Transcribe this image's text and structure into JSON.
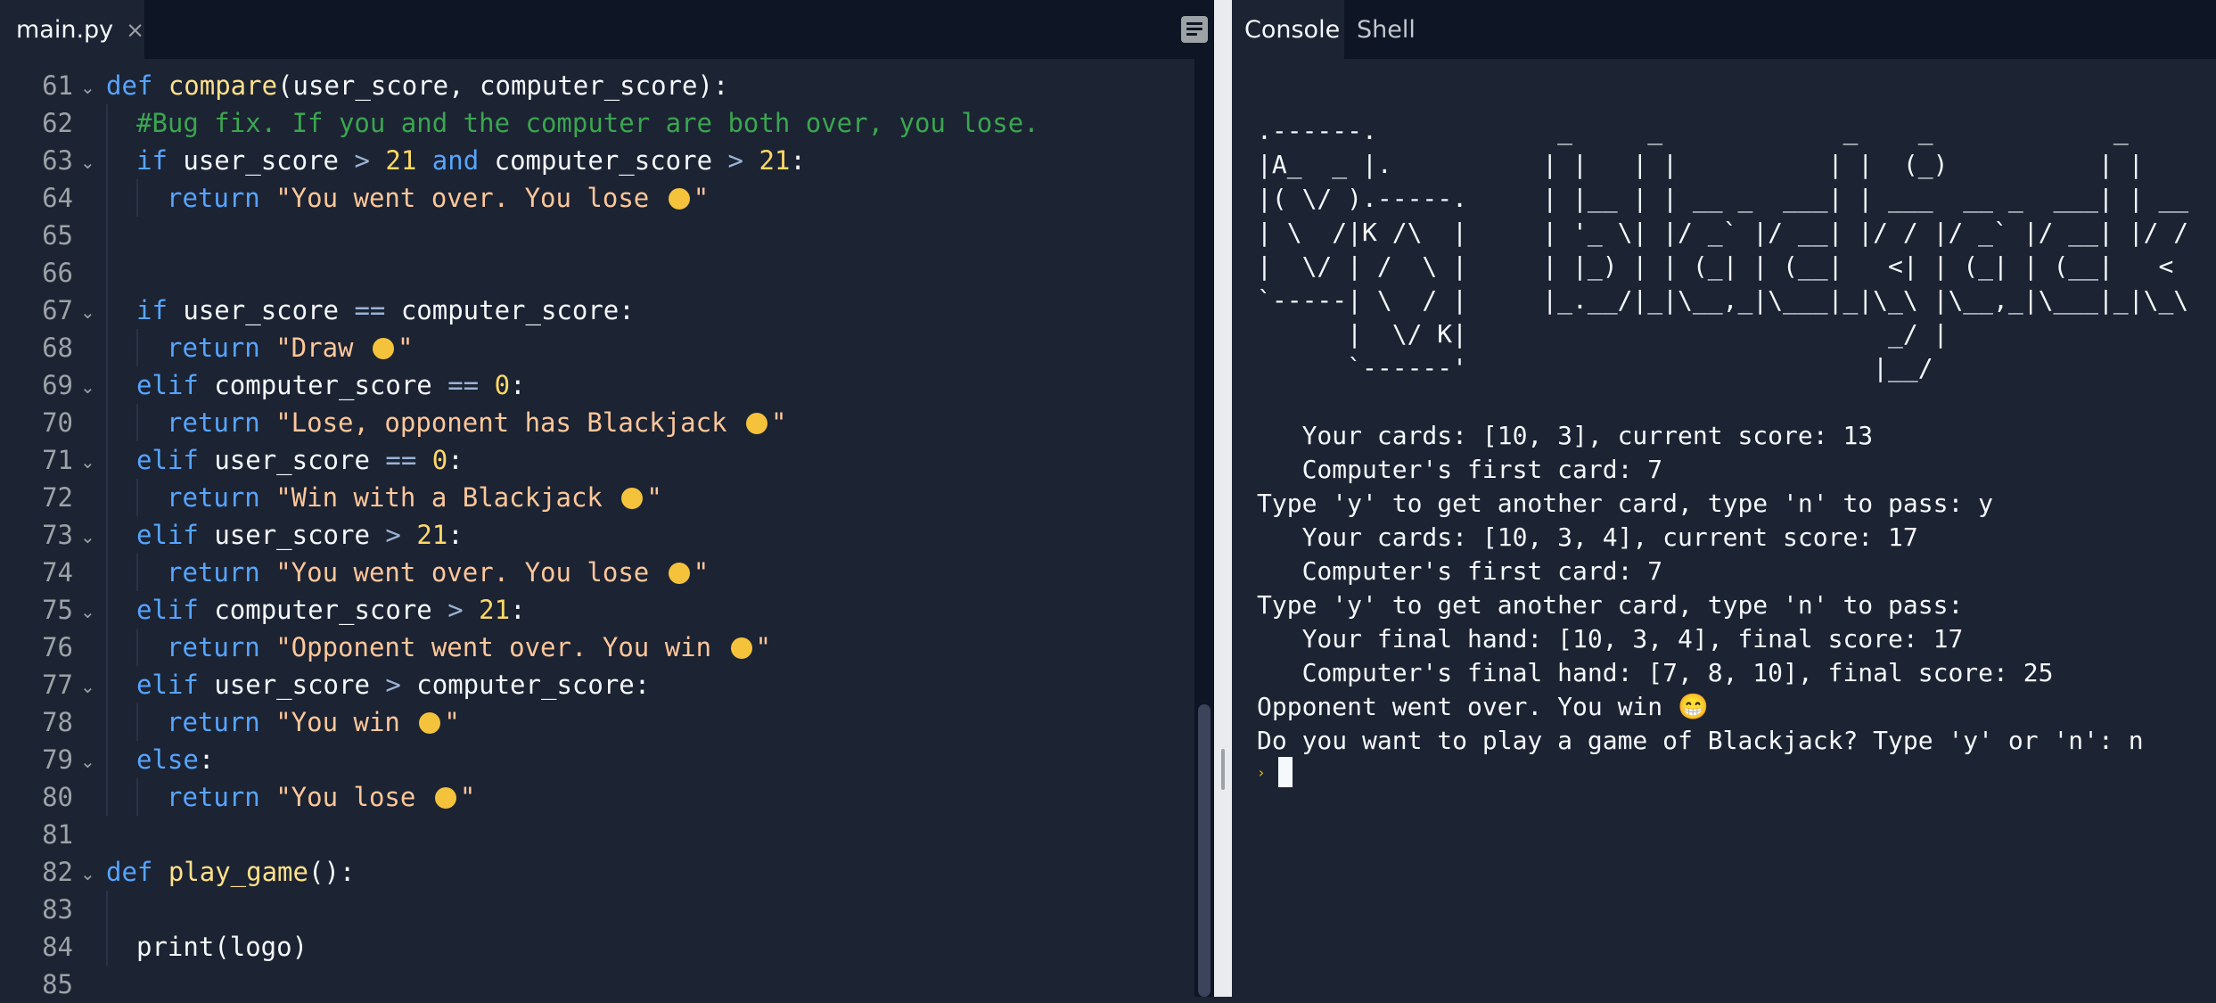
{
  "editor": {
    "file_tab": {
      "label": "main.py",
      "close": "×"
    },
    "panel_toggle_icon": "sidebar-toggle",
    "lines": [
      {
        "n": "61",
        "fold": true,
        "indent": 0,
        "parts": [
          [
            "kw",
            "def "
          ],
          [
            "fn",
            "compare"
          ],
          [
            "",
            "(user_score, computer_score):"
          ]
        ]
      },
      {
        "n": "62",
        "fold": false,
        "indent": 1,
        "parts": [
          [
            "cm",
            "#Bug fix. If you and the computer are both over, you lose."
          ]
        ]
      },
      {
        "n": "63",
        "fold": true,
        "indent": 1,
        "parts": [
          [
            "kw",
            "if "
          ],
          [
            "",
            "user_score "
          ],
          [
            "op",
            ">"
          ],
          [
            "",
            " "
          ],
          [
            "num",
            "21"
          ],
          [
            "",
            " "
          ],
          [
            "kw",
            "and"
          ],
          [
            "",
            " computer_score "
          ],
          [
            "op",
            ">"
          ],
          [
            "",
            " "
          ],
          [
            "num",
            "21"
          ],
          [
            "",
            ":"
          ]
        ]
      },
      {
        "n": "64",
        "fold": false,
        "indent": 2,
        "parts": [
          [
            "kw",
            "return "
          ],
          [
            "str",
            "\"You went over. You lose "
          ],
          [
            "emoji",
            "😤"
          ],
          [
            "str",
            "\""
          ]
        ]
      },
      {
        "n": "65",
        "fold": false,
        "indent": 1,
        "parts": []
      },
      {
        "n": "66",
        "fold": false,
        "indent": 1,
        "parts": []
      },
      {
        "n": "67",
        "fold": true,
        "indent": 1,
        "parts": [
          [
            "kw",
            "if "
          ],
          [
            "",
            "user_score "
          ],
          [
            "op",
            "=="
          ],
          [
            "",
            " computer_score:"
          ]
        ]
      },
      {
        "n": "68",
        "fold": false,
        "indent": 2,
        "parts": [
          [
            "kw",
            "return "
          ],
          [
            "str",
            "\"Draw "
          ],
          [
            "emoji",
            "🙃"
          ],
          [
            "str",
            "\""
          ]
        ]
      },
      {
        "n": "69",
        "fold": true,
        "indent": 1,
        "parts": [
          [
            "kw",
            "elif "
          ],
          [
            "",
            "computer_score "
          ],
          [
            "op",
            "=="
          ],
          [
            "",
            " "
          ],
          [
            "num",
            "0"
          ],
          [
            "",
            ":"
          ]
        ]
      },
      {
        "n": "70",
        "fold": false,
        "indent": 2,
        "parts": [
          [
            "kw",
            "return "
          ],
          [
            "str",
            "\"Lose, opponent has Blackjack "
          ],
          [
            "emoji",
            "😱"
          ],
          [
            "str",
            "\""
          ]
        ]
      },
      {
        "n": "71",
        "fold": true,
        "indent": 1,
        "parts": [
          [
            "kw",
            "elif "
          ],
          [
            "",
            "user_score "
          ],
          [
            "op",
            "=="
          ],
          [
            "",
            " "
          ],
          [
            "num",
            "0"
          ],
          [
            "",
            ":"
          ]
        ]
      },
      {
        "n": "72",
        "fold": false,
        "indent": 2,
        "parts": [
          [
            "kw",
            "return "
          ],
          [
            "str",
            "\"Win with a Blackjack "
          ],
          [
            "emoji",
            "😎"
          ],
          [
            "str",
            "\""
          ]
        ]
      },
      {
        "n": "73",
        "fold": true,
        "indent": 1,
        "parts": [
          [
            "kw",
            "elif "
          ],
          [
            "",
            "user_score "
          ],
          [
            "op",
            ">"
          ],
          [
            "",
            " "
          ],
          [
            "num",
            "21"
          ],
          [
            "",
            ":"
          ]
        ]
      },
      {
        "n": "74",
        "fold": false,
        "indent": 2,
        "parts": [
          [
            "kw",
            "return "
          ],
          [
            "str",
            "\"You went over. You lose "
          ],
          [
            "emoji",
            "😭"
          ],
          [
            "str",
            "\""
          ]
        ]
      },
      {
        "n": "75",
        "fold": true,
        "indent": 1,
        "parts": [
          [
            "kw",
            "elif "
          ],
          [
            "",
            "computer_score "
          ],
          [
            "op",
            ">"
          ],
          [
            "",
            " "
          ],
          [
            "num",
            "21"
          ],
          [
            "",
            ":"
          ]
        ]
      },
      {
        "n": "76",
        "fold": false,
        "indent": 2,
        "parts": [
          [
            "kw",
            "return "
          ],
          [
            "str",
            "\"Opponent went over. You win "
          ],
          [
            "emoji",
            "😁"
          ],
          [
            "str",
            "\""
          ]
        ]
      },
      {
        "n": "77",
        "fold": true,
        "indent": 1,
        "parts": [
          [
            "kw",
            "elif "
          ],
          [
            "",
            "user_score "
          ],
          [
            "op",
            ">"
          ],
          [
            "",
            " computer_score:"
          ]
        ]
      },
      {
        "n": "78",
        "fold": false,
        "indent": 2,
        "parts": [
          [
            "kw",
            "return "
          ],
          [
            "str",
            "\"You win "
          ],
          [
            "emoji",
            "😃"
          ],
          [
            "str",
            "\""
          ]
        ]
      },
      {
        "n": "79",
        "fold": true,
        "indent": 1,
        "parts": [
          [
            "kw",
            "else"
          ],
          [
            "",
            ":"
          ]
        ]
      },
      {
        "n": "80",
        "fold": false,
        "indent": 2,
        "parts": [
          [
            "kw",
            "return "
          ],
          [
            "str",
            "\"You lose "
          ],
          [
            "emoji",
            "😤"
          ],
          [
            "str",
            "\""
          ]
        ]
      },
      {
        "n": "81",
        "fold": false,
        "indent": 0,
        "parts": []
      },
      {
        "n": "82",
        "fold": true,
        "indent": 0,
        "parts": [
          [
            "kw",
            "def "
          ],
          [
            "fn",
            "play_game"
          ],
          [
            "",
            "():"
          ]
        ]
      },
      {
        "n": "83",
        "fold": false,
        "indent": 1,
        "parts": []
      },
      {
        "n": "84",
        "fold": false,
        "indent": 1,
        "parts": [
          [
            "",
            "print(logo)"
          ]
        ]
      },
      {
        "n": "85",
        "fold": false,
        "indent": 0,
        "parts": []
      }
    ]
  },
  "console": {
    "tabs": [
      {
        "label": "Console",
        "active": true
      },
      {
        "label": "Shell",
        "active": false
      }
    ],
    "output": ".------.            _     _            _    _            _    \n|A_  _ |.          | |   | |          | |  (_)          | |   \n|( \\/ ).-----.     | |__ | | __ _  ___| | ___  __ _  ___| | __\n| \\  /|K /\\  |     | '_ \\| |/ _` |/ __| |/ / |/ _` |/ __| |/ /\n|  \\/ | /  \\ |     | |_) | | (_| | (__|   <| | (_| | (__|   < \n`-----| \\  / |     |_.__/|_|\\__,_|\\___|_|\\_\\ |\\__,_|\\___|_|\\_\\\n      |  \\/ K|                            _/ |                \n      `------'                           |__/                 \n\n   Your cards: [10, 3], current score: 13\n   Computer's first card: 7\nType 'y' to get another card, type 'n' to pass: y\n   Your cards: [10, 3, 4], current score: 17\n   Computer's first card: 7\nType 'y' to get another card, type 'n' to pass: \n   Your final hand: [10, 3, 4], final score: 17\n   Computer's final hand: [7, 8, 10], final score: 25\nOpponent went over. You win 😁\nDo you want to play a game of Blackjack? Type 'y' or 'n': n",
    "prompt_symbol": "›"
  },
  "colors": {
    "background": "#1c2333",
    "tabbar": "#0e1525",
    "keyword": "#56a5ff",
    "function": "#ffe08a",
    "string": "#ffc799",
    "number": "#ffd966",
    "comment": "#3aa64f"
  }
}
